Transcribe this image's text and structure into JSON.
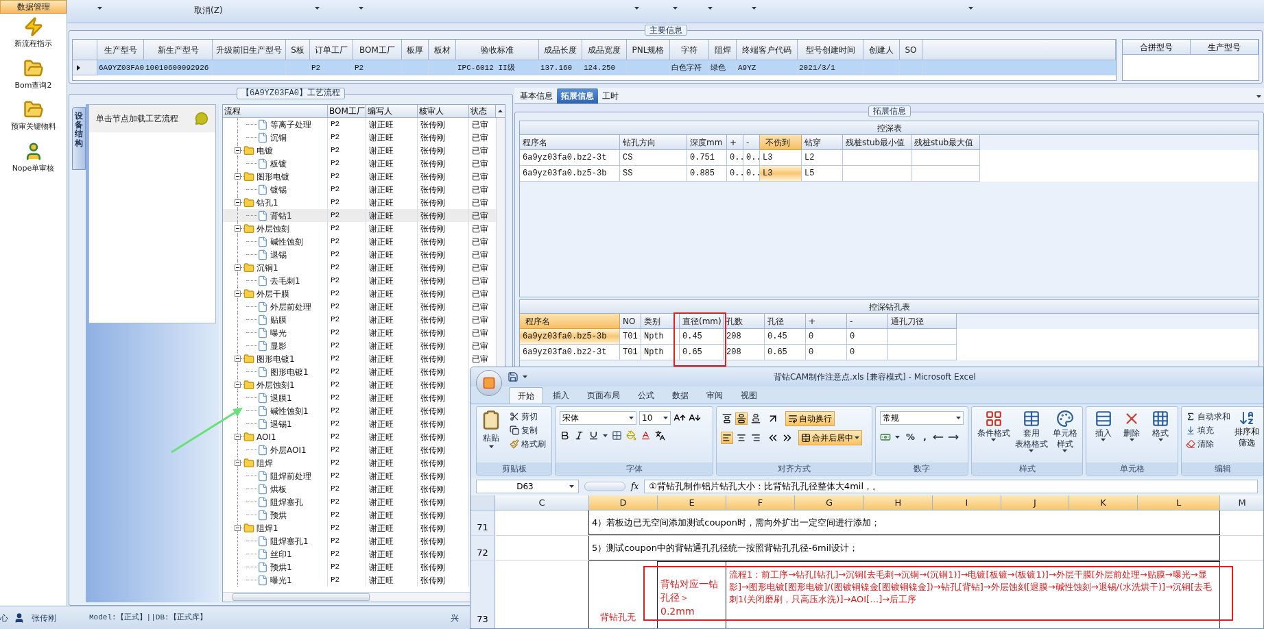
{
  "toolbar": {
    "menu_label": "取消(Z)"
  },
  "sidebar": {
    "header": "数据管理",
    "items": [
      {
        "label": "新流程指示",
        "kind": "bolt"
      },
      {
        "label": "Bom查询2",
        "kind": "folder"
      },
      {
        "label": "预审关键物料",
        "kind": "folder"
      },
      {
        "label": "Nope单审核",
        "kind": "user"
      }
    ]
  },
  "main_info": {
    "title": "主要信息",
    "columns": [
      "生产型号",
      "新生产型号",
      "升级前旧生产型号",
      "S板",
      "订单工厂",
      "BOM工厂",
      "板厚",
      "板材",
      "验收标准",
      "成品长度",
      "成品宽度",
      "PNL规格",
      "字符",
      "阻焊",
      "终端客户代码",
      "型号创建时间",
      "创建人",
      "SO"
    ],
    "rows": [
      {
        "selected": true,
        "cells": [
          "6A9YZ03FA0",
          "10010600092926",
          null,
          null,
          "P2",
          "P2",
          null,
          null,
          "IPC-6012 II级",
          "137.160",
          "124.250",
          null,
          "白色字符",
          "绿色",
          "A9YZ",
          "2021/3/1",
          null,
          null
        ]
      }
    ],
    "merge_columns": [
      "合拼型号",
      "生产型号"
    ]
  },
  "process_panel": {
    "title": "【6A9YZ03FA0】工艺流程",
    "side_tab": "设备结构",
    "hint": "单击节点加载工艺流程",
    "columns": [
      "流程",
      "BOM工厂",
      "编写人",
      "核审人",
      "状态"
    ],
    "nodes": [
      {
        "kind": "file",
        "name": "等离子处理",
        "bom": "P2",
        "writer": "谢正旺",
        "reviewer": "张传刚",
        "status": "已审",
        "selected": false
      },
      {
        "kind": "file",
        "name": "沉铜",
        "bom": "P2",
        "writer": "谢正旺",
        "reviewer": "张传刚",
        "status": "已审",
        "selected": false
      },
      {
        "kind": "folder",
        "name": "电镀",
        "bom": "P2",
        "writer": "谢正旺",
        "reviewer": "张传刚",
        "status": "已审",
        "selected": false,
        "expanded": true,
        "children": [
          {
            "kind": "file",
            "name": "板镀",
            "bom": "P2",
            "writer": "谢正旺",
            "reviewer": "张传刚",
            "status": "已审",
            "selected": false
          }
        ]
      },
      {
        "kind": "folder",
        "name": "图形电镀",
        "bom": "P2",
        "writer": "谢正旺",
        "reviewer": "张传刚",
        "status": "已审",
        "selected": false,
        "expanded": true,
        "children": [
          {
            "kind": "file",
            "name": "镀锡",
            "bom": "P2",
            "writer": "谢正旺",
            "reviewer": "张传刚",
            "status": "已审",
            "selected": false
          }
        ]
      },
      {
        "kind": "folder",
        "name": "钻孔1",
        "bom": "P2",
        "writer": "谢正旺",
        "reviewer": "张传刚",
        "status": "已审",
        "selected": false,
        "expanded": true,
        "children": [
          {
            "kind": "file",
            "name": "背钻1",
            "bom": "P2",
            "writer": "谢正旺",
            "reviewer": "张传刚",
            "status": "已审",
            "selected": true
          }
        ]
      },
      {
        "kind": "folder",
        "name": "外层蚀刻",
        "bom": "P2",
        "writer": "谢正旺",
        "reviewer": "张传刚",
        "status": "已审",
        "selected": false,
        "expanded": true,
        "children": [
          {
            "kind": "file",
            "name": "碱性蚀刻",
            "bom": "P2",
            "writer": "谢正旺",
            "reviewer": "张传刚",
            "status": "已审",
            "selected": false
          },
          {
            "kind": "file",
            "name": "退锡",
            "bom": "P2",
            "writer": "谢正旺",
            "reviewer": "张传刚",
            "status": "已审",
            "selected": false
          }
        ]
      },
      {
        "kind": "folder",
        "name": "沉铜1",
        "bom": "P2",
        "writer": "谢正旺",
        "reviewer": "张传刚",
        "status": "已审",
        "selected": false,
        "expanded": true,
        "children": [
          {
            "kind": "file",
            "name": "去毛刺1",
            "bom": "P2",
            "writer": "谢正旺",
            "reviewer": "张传刚",
            "status": "已审",
            "selected": false
          }
        ]
      },
      {
        "kind": "folder",
        "name": "外层干膜",
        "bom": "P2",
        "writer": "谢正旺",
        "reviewer": "张传刚",
        "status": "已审",
        "selected": false,
        "expanded": true,
        "children": [
          {
            "kind": "file",
            "name": "外层前处理",
            "bom": "P2",
            "writer": "谢正旺",
            "reviewer": "张传刚",
            "status": "已审",
            "selected": false
          },
          {
            "kind": "file",
            "name": "贴膜",
            "bom": "P2",
            "writer": "谢正旺",
            "reviewer": "张传刚",
            "status": "已审",
            "selected": false
          },
          {
            "kind": "file",
            "name": "曝光",
            "bom": "P2",
            "writer": "谢正旺",
            "reviewer": "张传刚",
            "status": "已审",
            "selected": false
          },
          {
            "kind": "file",
            "name": "显影",
            "bom": "P2",
            "writer": "谢正旺",
            "reviewer": "张传刚",
            "status": "已审",
            "selected": false
          }
        ]
      },
      {
        "kind": "folder",
        "name": "图形电镀1",
        "bom": "P2",
        "writer": "谢正旺",
        "reviewer": "张传刚",
        "status": "已审",
        "selected": false,
        "expanded": true,
        "children": [
          {
            "kind": "file",
            "name": "图形电镀1",
            "bom": "P2",
            "writer": "谢正旺",
            "reviewer": "张传刚",
            "selected": false
          }
        ]
      },
      {
        "kind": "folder",
        "name": "外层蚀刻1",
        "bom": "P2",
        "writer": "谢正旺",
        "reviewer": "张传刚",
        "selected": false,
        "expanded": true,
        "children": [
          {
            "kind": "file",
            "name": "退膜1",
            "bom": "P2",
            "writer": "谢正旺",
            "reviewer": "张传刚",
            "selected": false
          },
          {
            "kind": "file",
            "name": "碱性蚀刻1",
            "bom": "P2",
            "writer": "谢正旺",
            "reviewer": "张传刚",
            "selected": false
          },
          {
            "kind": "file",
            "name": "退锡1",
            "bom": "P2",
            "writer": "谢正旺",
            "reviewer": "张传刚",
            "selected": false
          }
        ]
      },
      {
        "kind": "folder",
        "name": "AOI1",
        "bom": "P2",
        "writer": "谢正旺",
        "reviewer": "张传刚",
        "selected": false,
        "expanded": true,
        "children": [
          {
            "kind": "file",
            "name": "外层AOI1",
            "bom": "P2",
            "writer": "谢正旺",
            "reviewer": "张传刚",
            "selected": false
          }
        ]
      },
      {
        "kind": "folder",
        "name": "阻焊",
        "bom": "P2",
        "writer": "谢正旺",
        "reviewer": "张传刚",
        "selected": false,
        "expanded": true,
        "children": [
          {
            "kind": "file",
            "name": "阻焊前处理",
            "bom": "P2",
            "writer": "谢正旺",
            "reviewer": "张传刚",
            "selected": false
          },
          {
            "kind": "file",
            "name": "烘板",
            "bom": "P2",
            "writer": "谢正旺",
            "reviewer": "张传刚",
            "selected": false
          },
          {
            "kind": "file",
            "name": "阻焊塞孔",
            "bom": "P2",
            "writer": "谢正旺",
            "reviewer": "张传刚",
            "selected": false
          },
          {
            "kind": "file",
            "name": "预烘",
            "bom": "P2",
            "writer": "谢正旺",
            "reviewer": "张传刚",
            "selected": false
          }
        ]
      },
      {
        "kind": "folder",
        "name": "阻焊1",
        "bom": "P2",
        "writer": "谢正旺",
        "reviewer": "张传刚",
        "selected": false,
        "expanded": true,
        "children": [
          {
            "kind": "file",
            "name": "阻焊塞孔1",
            "bom": "P2",
            "writer": "谢正旺",
            "reviewer": "张传刚",
            "selected": false
          },
          {
            "kind": "file",
            "name": "丝印1",
            "bom": "P2",
            "writer": "谢正旺",
            "reviewer": "张传刚",
            "selected": false
          },
          {
            "kind": "file",
            "name": "预烘1",
            "bom": "P2",
            "writer": "谢正旺",
            "reviewer": "张传刚",
            "selected": false
          },
          {
            "kind": "file",
            "name": "曝光1",
            "bom": "P2",
            "writer": "谢正旺",
            "reviewer": "张传刚",
            "selected": false
          }
        ]
      }
    ]
  },
  "detail_panel": {
    "tabs": [
      {
        "label": "基本信息",
        "selected": false
      },
      {
        "label": "拓展信息",
        "selected": true
      },
      {
        "label": "工时",
        "selected": false
      }
    ],
    "group_title": "拓展信息",
    "depth_table": {
      "title": "控深表",
      "columns": [
        {
          "label": "程序名",
          "selected": false
        },
        {
          "label": "钻孔方向",
          "selected": false
        },
        {
          "label": "深度mm",
          "selected": false
        },
        {
          "label": "+",
          "selected": false
        },
        {
          "label": "-",
          "selected": false
        },
        {
          "label": "不伤到",
          "selected": true
        },
        {
          "label": "钻穿",
          "selected": false
        },
        {
          "label": "残桩stub最小值",
          "selected": false
        },
        {
          "label": "残桩stub最大值",
          "selected": false
        }
      ],
      "rows": [
        {
          "selected": false,
          "cells": [
            "6a9yz03fa0.bz2-3t",
            "CS",
            "0.751",
            "0..",
            "0..",
            "L3",
            "L2",
            null,
            null
          ]
        },
        {
          "selected": true,
          "cells": [
            "6a9yz03fa0.bz5-3b",
            "SS",
            "0.885",
            "0..",
            "0..",
            "L3",
            "L5",
            null,
            null
          ]
        }
      ]
    },
    "drill_table": {
      "title": "控深钻孔表",
      "columns": [
        {
          "label": "程序名",
          "selected": true
        },
        {
          "label": "NO",
          "selected": false
        },
        {
          "label": "类别",
          "selected": false
        },
        {
          "label": "直径(mm)",
          "selected": false
        },
        {
          "label": "孔数",
          "selected": false
        },
        {
          "label": "孔径",
          "selected": false
        },
        {
          "label": "+",
          "selected": false
        },
        {
          "label": "-",
          "selected": false
        },
        {
          "label": "通孔刀径",
          "selected": false
        }
      ],
      "rows": [
        {
          "selected": true,
          "cells": [
            "6a9yz03fa0.bz5-3b",
            "T01",
            "Npth",
            "0.45",
            "208",
            "0.45",
            "0",
            "0",
            null
          ]
        },
        {
          "selected": false,
          "cells": [
            "6a9yz03fa0.bz2-3t",
            "T01",
            "Npth",
            "0.65",
            "208",
            "0.65",
            "0",
            "0",
            null
          ]
        }
      ]
    }
  },
  "excel": {
    "title": "背钻CAM制作注意点.xls  [兼容模式] - Microsoft Excel",
    "tabs": [
      {
        "label": "开始",
        "selected": true
      },
      {
        "label": "插入",
        "selected": false
      },
      {
        "label": "页面布局",
        "selected": false
      },
      {
        "label": "公式",
        "selected": false
      },
      {
        "label": "数据",
        "selected": false
      },
      {
        "label": "审阅",
        "selected": false
      },
      {
        "label": "视图",
        "selected": false
      }
    ],
    "ribbon": [
      {
        "kind": "clipboard",
        "label": "剪贴板",
        "big": "粘贴",
        "items": [
          "剪切",
          "复制",
          "格式刷"
        ]
      },
      {
        "kind": "font",
        "label": "字体",
        "font": "宋体",
        "size": "10"
      },
      {
        "kind": "align",
        "label": "对齐方式",
        "vertical": [
          {
            "on": false
          },
          {
            "on": true
          },
          {
            "on": false
          }
        ],
        "horizontal": [
          {
            "on": true
          },
          {
            "on": false
          },
          {
            "on": false
          }
        ],
        "items": [
          {
            "label": "自动换行",
            "on": true
          },
          {
            "label": "合并后居中",
            "on": true
          }
        ]
      },
      {
        "kind": "number",
        "label": "数字",
        "format": "常规",
        "symbols": [
          "%",
          ","
        ]
      },
      {
        "kind": "styles",
        "label": "样式",
        "items": [
          {
            "lines": [
              "条件格式"
            ]
          },
          {
            "lines": [
              "套用",
              "表格格式"
            ]
          },
          {
            "lines": [
              "单元格",
              "样式"
            ]
          }
        ]
      },
      {
        "kind": "cells",
        "label": "单元格",
        "items": [
          {
            "lines": [
              "插入"
            ]
          },
          {
            "lines": [
              "删除"
            ]
          },
          {
            "lines": [
              "格式"
            ]
          }
        ]
      },
      {
        "kind": "edit",
        "label": "编辑",
        "items": [
          "自动求和",
          "填充",
          "清除"
        ],
        "sort": [
          "排序和",
          "筛选"
        ]
      }
    ],
    "name_box": "D63",
    "function_label": "fx",
    "formula": "①背钻孔制作铝片钻孔大小：比背钻孔孔径整体大4mil，。",
    "columns": [
      {
        "label": "C",
        "selected": false
      },
      {
        "label": "D",
        "selected": true
      },
      {
        "label": "E",
        "selected": true
      },
      {
        "label": "F",
        "selected": true
      },
      {
        "label": "G",
        "selected": true
      },
      {
        "label": "H",
        "selected": true
      },
      {
        "label": "I",
        "selected": true
      },
      {
        "label": "J",
        "selected": true
      },
      {
        "label": "K",
        "selected": true
      },
      {
        "label": "L",
        "selected": true
      },
      {
        "label": "M",
        "selected": false
      }
    ],
    "rows": [
      {
        "kind": "note",
        "number": "71",
        "text": "4）若板边已无空间添加测试coupon时，需向外扩出一定空间进行添加；"
      },
      {
        "kind": "note",
        "number": "72",
        "text": "5）测试coupon中的背钻通孔孔径统一按照背钻孔孔径-6mil设计；"
      },
      {
        "kind": "flow",
        "number": "73",
        "label": "背钻孔无",
        "condition": "背钻对应一钻孔径＞0.2mm",
        "flow": "流程1：前工序→钻孔[钻孔]→沉铜[去毛刺→沉铜→(沉铜1)]→电镀[板镀→(板镀1)]→外层干膜[外层前处理→贴膜→曝光→显影]→图形电镀[图形电镀]/(图镀铜镍金[图镀铜镍金])→钻孔[背钻]→外层蚀刻[退膜→碱性蚀刻→退锡/(水洗烘干)]→沉铜[去毛刺1(关闭磨刷，只高压水洗)]→AOI[…]→后工序"
      }
    ]
  },
  "status_bar": {
    "left_text": "心",
    "user": "张传刚",
    "model_text": "Model:【正式】||DB:【正式库】",
    "company": "兴"
  }
}
